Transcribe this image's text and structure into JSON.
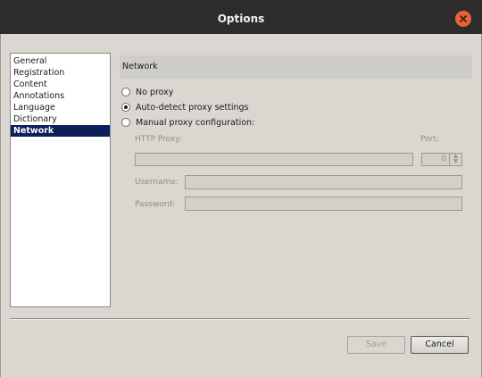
{
  "window": {
    "title": "Options"
  },
  "sidebar": {
    "items": [
      {
        "label": "General"
      },
      {
        "label": "Registration"
      },
      {
        "label": "Content"
      },
      {
        "label": "Annotations"
      },
      {
        "label": "Language"
      },
      {
        "label": "Dictionary"
      },
      {
        "label": "Network",
        "selected": true
      }
    ]
  },
  "network": {
    "section_title": "Network",
    "options": [
      {
        "label": "No proxy",
        "checked": false
      },
      {
        "label": "Auto-detect proxy settings",
        "checked": true
      },
      {
        "label": "Manual proxy configuration:",
        "checked": false
      }
    ],
    "http_proxy_label": "HTTP Proxy:",
    "http_proxy_value": "",
    "port_label": "Port:",
    "port_value": "0",
    "username_label": "Username:",
    "username_value": "",
    "password_label": "Password:",
    "password_value": ""
  },
  "buttons": {
    "save": "Save",
    "cancel": "Cancel"
  },
  "colors": {
    "selection": "#0c1f59",
    "close_button": "#e8613a",
    "titlebar": "#2c2c2c"
  }
}
